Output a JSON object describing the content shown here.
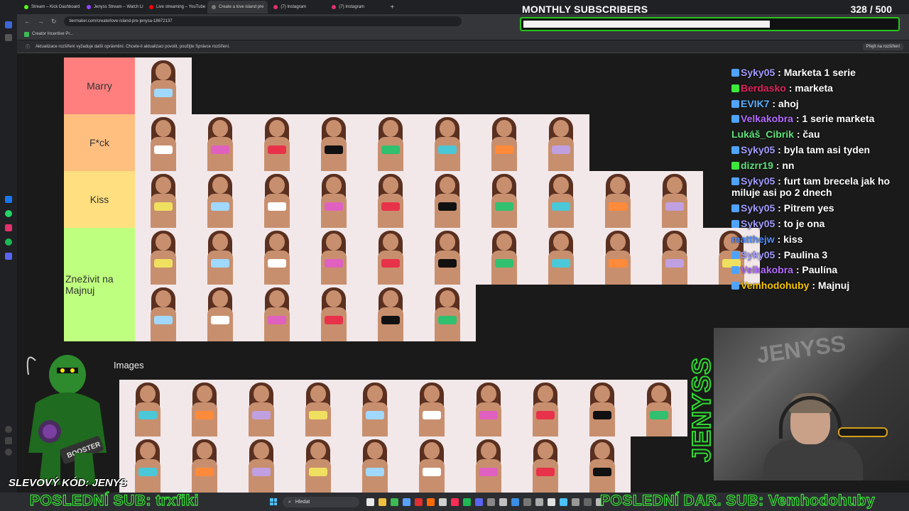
{
  "browser": {
    "tabs": [
      {
        "label": "Stream – Kick Dashboard",
        "color": "#53fc18"
      },
      {
        "label": "Jenyss Stream – Watch Live",
        "color": "#9146ff"
      },
      {
        "label": "Live streaming – YouTube",
        "color": "#ff0000"
      },
      {
        "label": "Create a love island pre",
        "color": "#7a7a7a",
        "active": true
      },
      {
        "label": "(7) Instagram",
        "color": "#e1306c"
      },
      {
        "label": "(7) Instagram",
        "color": "#e1306c"
      }
    ],
    "url": "tiermaker.com/create/love-island-pre-jenysa-18672137",
    "bookmark": "Creator Incentive Pr...",
    "infobar_text": "Aktualizace rozšíření vyžaduje další oprávnění. Chcete-li aktualizaci povolit, použijte Správce rozšíření.",
    "infobar_button": "Přejít na rozšíření"
  },
  "subscribers": {
    "title": "MONTHLY SUBSCRIBERS",
    "count": "328 / 500",
    "progress": 0.656,
    "accent": "#27c31c"
  },
  "tiers": [
    {
      "label": "Marry",
      "color": "#ff7f7f",
      "count": 1
    },
    {
      "label": "F*ck",
      "color": "#ffbf7f",
      "count": 8
    },
    {
      "label": "Kiss",
      "color": "#ffdf7f",
      "count": 10
    },
    {
      "label": "Zneživit na Majnuj",
      "color": "#bfff7f",
      "count": 17
    }
  ],
  "images_label": "Images",
  "unranked_count": 19,
  "chat": [
    {
      "user": "Syky05",
      "user_color": "#a29bfe",
      "text": "Marketa 1 serie",
      "badge": "#4fa3ff"
    },
    {
      "user": "Berdasko",
      "user_color": "#e0245e",
      "text": "marketa",
      "badge": "#3ce83c"
    },
    {
      "user": "EVIK7",
      "user_color": "#5ab0ff",
      "text": "ahoj",
      "badge": "#4fa3ff"
    },
    {
      "user": "Velkakobra",
      "user_color": "#b36bff",
      "text": "1 serie marketa",
      "badge": "#4fa3ff"
    },
    {
      "user": "Lukáš_Cibrik",
      "user_color": "#5ee37a",
      "text": "čau",
      "badge": ""
    },
    {
      "user": "Syky05",
      "user_color": "#a29bfe",
      "text": "byla tam asi tyden",
      "badge": "#4fa3ff"
    },
    {
      "user": "dizrr19",
      "user_color": "#5ee37a",
      "text": "nn",
      "badge": "#3ce83c"
    },
    {
      "user": "Syky05",
      "user_color": "#a29bfe",
      "text": "furt tam brecela jak ho miluje asi po 2 dnech",
      "badge": "#4fa3ff"
    },
    {
      "user": "Syky05",
      "user_color": "#a29bfe",
      "text": "Pitrem yes",
      "badge": "#4fa3ff"
    },
    {
      "user": "Syky05",
      "user_color": "#a29bfe",
      "text": "to je ona",
      "badge": "#4fa3ff"
    },
    {
      "user": "matthejw",
      "user_color": "#4f8cff",
      "text": "kiss",
      "badge": ""
    },
    {
      "user": "Syky05",
      "user_color": "#a29bfe",
      "text": "Paulina 3",
      "badge": "#4fa3ff"
    },
    {
      "user": "Velkakobra",
      "user_color": "#b36bff",
      "text": "Paulína",
      "badge": "#4fa3ff"
    },
    {
      "user": "Vemhodohuby",
      "user_color": "#f5c400",
      "text": "Majnuj",
      "badge": "#4fa3ff"
    }
  ],
  "overlay": {
    "vertical_brand": "JENYSS",
    "webcam_wall": "JENYSS",
    "coupon": "SLEVOVÝ KÓD: JENYS",
    "mascot_brand": "BOOSTER",
    "last_sub": "POSLEDNÍ SUB: trxfiki",
    "last_gift": "POSLEDNÍ DAR. SUB: Vemhodohuby"
  },
  "taskbar": {
    "search_placeholder": "Hledat"
  }
}
